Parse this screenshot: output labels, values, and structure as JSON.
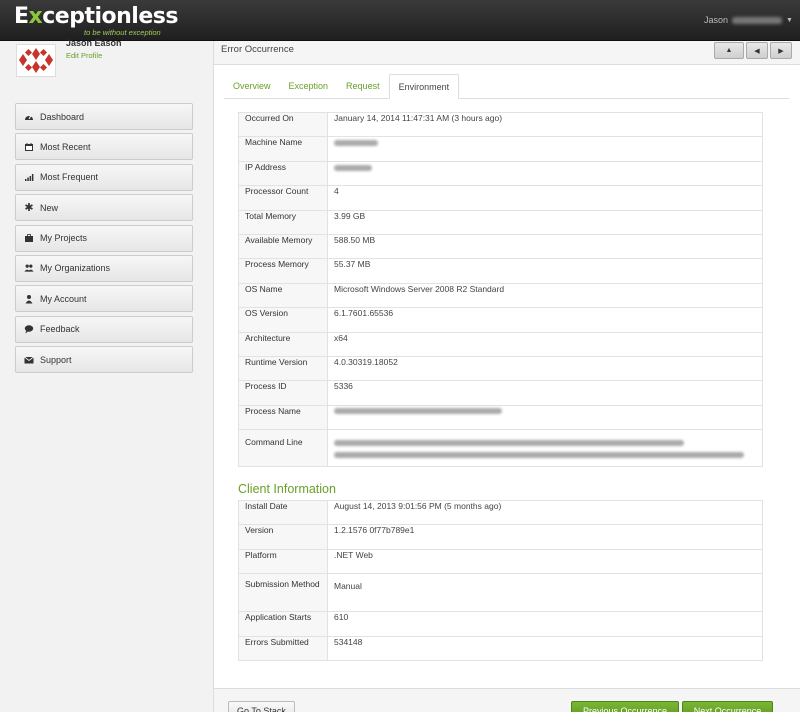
{
  "app": {
    "logo_prefix": "E",
    "logo_accent": "x",
    "logo_rest": "ceptionless",
    "tagline": "to be without exception",
    "user_name": "Jason"
  },
  "profile": {
    "name": "Jason Eason",
    "edit_label": "Edit Profile"
  },
  "sidebar": {
    "items": [
      {
        "label": "Dashboard",
        "icon": "dashboard-icon"
      },
      {
        "label": "Most Recent",
        "icon": "calendar-icon"
      },
      {
        "label": "Most Frequent",
        "icon": "signal-bars-icon"
      },
      {
        "label": "New",
        "icon": "asterisk-icon"
      },
      {
        "label": "My Projects",
        "icon": "briefcase-icon"
      },
      {
        "label": "My Organizations",
        "icon": "users-icon"
      },
      {
        "label": "My Account",
        "icon": "user-icon"
      },
      {
        "label": "Feedback",
        "icon": "comment-icon"
      },
      {
        "label": "Support",
        "icon": "envelope-icon"
      }
    ]
  },
  "panel": {
    "title": "Error Occurrence",
    "tabs": [
      "Overview",
      "Exception",
      "Request",
      "Environment"
    ],
    "active_tab": "Environment"
  },
  "environment": {
    "rows": [
      {
        "key": "Occurred On",
        "value": "January 14, 2014 11:47:31 AM (3 hours ago)"
      },
      {
        "key": "Machine Name",
        "value": ""
      },
      {
        "key": "IP Address",
        "value": ""
      },
      {
        "key": "Processor Count",
        "value": "4"
      },
      {
        "key": "Total Memory",
        "value": "3.99 GB"
      },
      {
        "key": "Available Memory",
        "value": "588.50 MB"
      },
      {
        "key": "Process Memory",
        "value": "55.37 MB"
      },
      {
        "key": "OS Name",
        "value": "Microsoft Windows Server 2008 R2 Standard"
      },
      {
        "key": "OS Version",
        "value": "6.1.7601.65536"
      },
      {
        "key": "Architecture",
        "value": "x64"
      },
      {
        "key": "Runtime Version",
        "value": "4.0.30319.18052"
      },
      {
        "key": "Process ID",
        "value": "5336"
      },
      {
        "key": "Process Name",
        "value": ""
      },
      {
        "key": "Command Line",
        "value": ""
      }
    ]
  },
  "client": {
    "title": "Client Information",
    "rows": [
      {
        "key": "Install Date",
        "value": "August 14, 2013 9:01:56 PM (5 months ago)"
      },
      {
        "key": "Version",
        "value": "1.2.1576 0f77b789e1"
      },
      {
        "key": "Platform",
        "value": ".NET Web"
      },
      {
        "key": "Submission Method",
        "value": "Manual"
      },
      {
        "key": "Application Starts",
        "value": "610"
      },
      {
        "key": "Errors Submitted",
        "value": "534148"
      }
    ]
  },
  "footer": {
    "go_to_stack": "Go To Stack",
    "previous": "Previous Occurrence",
    "next": "Next Occurrence"
  },
  "colors": {
    "accent": "#6a9f2a",
    "topbar": "#2b2b2b",
    "button_green": "#6aa82a"
  }
}
